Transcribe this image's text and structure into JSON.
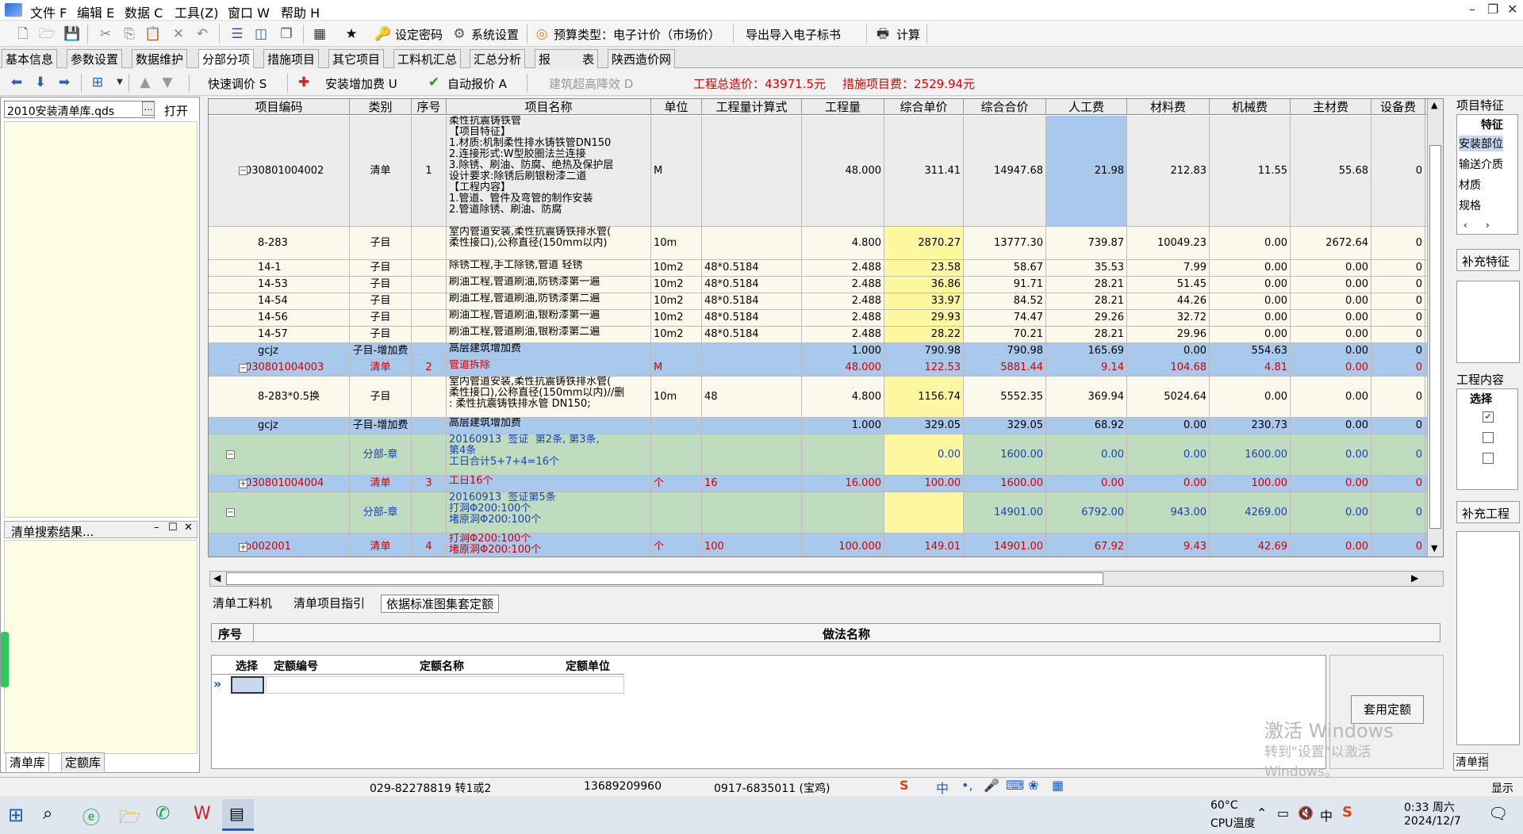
{
  "menu": [
    "文件 F",
    "编辑 E",
    "数据 C",
    "工具(Z)",
    "窗口 W",
    "帮助 H"
  ],
  "toolbar": {
    "set_password": "设定密码",
    "system_settings": "系统设置",
    "budget_type": "预算类型：电子计价（市场价）",
    "export_import": "导出导入电子标书",
    "calculate": "计算"
  },
  "tabs": [
    "基本信息",
    "参数设置",
    "数据维护",
    "分部分项",
    "措施项目",
    "其它项目",
    "工料机汇总",
    "汇总分析",
    "报",
    "表",
    "陕西造价网"
  ],
  "toolbar2": {
    "quick_adjust": "快速调价 S",
    "install_fee": "安装增加费 U",
    "auto_report": "自动报价 A",
    "building_over_height": "建筑超高降效 D",
    "total_cost": "工程总造价：43971.5元",
    "measure_cost": "措施项目费：2529.94元"
  },
  "left": {
    "library": "2010安装清单库.qds",
    "open_button": "打开",
    "search_results_title": "清单搜索结果...",
    "tab_list_lib": "清单库",
    "tab_quota_lib": "定额库"
  },
  "grid": {
    "headers": [
      "项目编码",
      "类别",
      "序号",
      "项目名称",
      "单位",
      "工程量计算式",
      "工程量",
      "综合单价",
      "综合合价",
      "人工费",
      "材料费",
      "机械费",
      "主材费",
      "设备费"
    ],
    "rows": [
      {
        "code": "030801004002",
        "type": "清单",
        "seq": "1",
        "name": "柔性抗震铸铁管\n【项目特征】\n1.材质:机制柔性排水铸铁管DN150\n2.连接形式:W型胶圈法兰连接\n3.除锈、刷油、防腐、绝热及保护层\n设计要求:除锈后刷银粉漆二道\n【工程内容】\n1.管道、管件及弯管的制作安装\n2.管道除锈、刷油、防腐",
        "unit": "M",
        "formula": "",
        "qty": "48.000",
        "unit_price": "311.41",
        "total": "14947.68",
        "labor": "21.98",
        "material": "212.83",
        "machine": "11.55",
        "main_mat": "55.68",
        "equip": "0",
        "style": "qd",
        "expander": "−"
      },
      {
        "code": "8-283",
        "type": "子目",
        "seq": "",
        "name": "室内管道安装,柔性抗震铸铁排水管(\n柔性接口),公称直径(150mm以内)",
        "unit": "10m",
        "formula": "",
        "qty": "4.800",
        "unit_price": "2870.27",
        "total": "13777.30",
        "labor": "739.87",
        "material": "10049.23",
        "machine": "0.00",
        "main_mat": "2672.64",
        "equip": "0",
        "style": "zm",
        "expander": ""
      },
      {
        "code": "14-1",
        "type": "子目",
        "seq": "",
        "name": "除锈工程,手工除锈,管道 轻锈",
        "unit": "10m2",
        "formula": "48*0.5184",
        "qty": "2.488",
        "unit_price": "23.58",
        "total": "58.67",
        "labor": "35.53",
        "material": "7.99",
        "machine": "0.00",
        "main_mat": "0.00",
        "equip": "0",
        "style": "zm",
        "expander": ""
      },
      {
        "code": "14-53",
        "type": "子目",
        "seq": "",
        "name": "刷油工程,管道刷油,防锈漆第一遍",
        "unit": "10m2",
        "formula": "48*0.5184",
        "qty": "2.488",
        "unit_price": "36.86",
        "total": "91.71",
        "labor": "28.21",
        "material": "51.45",
        "machine": "0.00",
        "main_mat": "0.00",
        "equip": "0",
        "style": "zm",
        "expander": ""
      },
      {
        "code": "14-54",
        "type": "子目",
        "seq": "",
        "name": "刷油工程,管道刷油,防锈漆第二遍",
        "unit": "10m2",
        "formula": "48*0.5184",
        "qty": "2.488",
        "unit_price": "33.97",
        "total": "84.52",
        "labor": "28.21",
        "material": "44.26",
        "machine": "0.00",
        "main_mat": "0.00",
        "equip": "0",
        "style": "zm",
        "expander": ""
      },
      {
        "code": "14-56",
        "type": "子目",
        "seq": "",
        "name": "刷油工程,管道刷油,银粉漆第一遍",
        "unit": "10m2",
        "formula": "48*0.5184",
        "qty": "2.488",
        "unit_price": "29.93",
        "total": "74.47",
        "labor": "29.26",
        "material": "32.72",
        "machine": "0.00",
        "main_mat": "0.00",
        "equip": "0",
        "style": "zm",
        "expander": ""
      },
      {
        "code": "14-57",
        "type": "子目",
        "seq": "",
        "name": "刷油工程,管道刷油,银粉漆第二遍",
        "unit": "10m2",
        "formula": "48*0.5184",
        "qty": "2.488",
        "unit_price": "28.22",
        "total": "70.21",
        "labor": "28.21",
        "material": "29.96",
        "machine": "0.00",
        "main_mat": "0.00",
        "equip": "0",
        "style": "zm",
        "expander": ""
      },
      {
        "code": "gcjz",
        "type": "子目-增加费",
        "seq": "",
        "name": "高层建筑增加费",
        "unit": "",
        "formula": "",
        "qty": "1.000",
        "unit_price": "790.98",
        "total": "790.98",
        "labor": "165.69",
        "material": "0.00",
        "machine": "554.63",
        "main_mat": "0.00",
        "equip": "0",
        "style": "blue",
        "expander": ""
      },
      {
        "code": "030801004003",
        "type": "清单",
        "seq": "2",
        "name": "管道拆除",
        "unit": "M",
        "formula": "",
        "qty": "48.000",
        "unit_price": "122.53",
        "total": "5881.44",
        "labor": "9.14",
        "material": "104.68",
        "machine": "4.81",
        "main_mat": "0.00",
        "equip": "0",
        "style": "bluered",
        "expander": "−"
      },
      {
        "code": "8-283*0.5换",
        "type": "子目",
        "seq": "",
        "name": "室内管道安装,柔性抗震铸铁排水管(\n柔性接口),公称直径(150mm以内)//删\n: 柔性抗震铸铁排水管 DN150;",
        "unit": "10m",
        "formula": "48",
        "qty": "4.800",
        "unit_price": "1156.74",
        "total": "5552.35",
        "labor": "369.94",
        "material": "5024.64",
        "machine": "0.00",
        "main_mat": "0.00",
        "equip": "0",
        "style": "zm",
        "expander": ""
      },
      {
        "code": "gcjz",
        "type": "子目-增加费",
        "seq": "",
        "name": "高层建筑增加费",
        "unit": "",
        "formula": "",
        "qty": "1.000",
        "unit_price": "329.05",
        "total": "329.05",
        "labor": "68.92",
        "material": "0.00",
        "machine": "230.73",
        "main_mat": "0.00",
        "equip": "0",
        "style": "blue",
        "expander": ""
      },
      {
        "code": "",
        "type": "分部-章",
        "seq": "",
        "name": "20160913  签证  第2条, 第3条,\n第4条\n工日合计5+7+4=16个",
        "unit": "",
        "formula": "",
        "qty": "",
        "unit_price": "0.00",
        "total": "1600.00",
        "labor": "0.00",
        "material": "0.00",
        "machine": "1600.00",
        "main_mat": "0.00",
        "equip": "0",
        "style": "green",
        "expander": "−"
      },
      {
        "code": "030801004004",
        "type": "清单",
        "seq": "3",
        "name": "工日16个",
        "unit": "个",
        "formula": "16",
        "qty": "16.000",
        "unit_price": "100.00",
        "total": "1600.00",
        "labor": "0.00",
        "material": "0.00",
        "machine": "100.00",
        "main_mat": "0.00",
        "equip": "0",
        "style": "bluered",
        "expander": "+"
      },
      {
        "code": "",
        "type": "分部-章",
        "seq": "",
        "name": "20160913  签证第5条\n打洞Φ200:100个\n堵原洞Φ200:100个",
        "unit": "",
        "formula": "",
        "qty": "",
        "unit_price": "",
        "total": "14901.00",
        "labor": "6792.00",
        "material": "943.00",
        "machine": "4269.00",
        "main_mat": "0.00",
        "equip": "0",
        "style": "green",
        "expander": "−"
      },
      {
        "code": "b002001",
        "type": "清单",
        "seq": "4",
        "name": "打洞Φ200:100个\n堵原洞Φ200:100个",
        "unit": "个",
        "formula": "100",
        "qty": "100.000",
        "unit_price": "149.01",
        "total": "14901.00",
        "labor": "67.92",
        "material": "9.43",
        "machine": "42.69",
        "main_mat": "0.00",
        "equip": "0",
        "style": "bluered",
        "expander": "+"
      }
    ]
  },
  "bottom": {
    "tabs": [
      "清单工料机",
      "清单项目指引",
      "依据标准图集套定额"
    ],
    "header_seq": "序号",
    "header_method": "做法名称",
    "sub_headers": [
      "选择",
      "定额编号",
      "定额名称",
      "定额单位"
    ],
    "apply_button": "套用定额",
    "activate_line1": "激活 Windows",
    "activate_line2": "转到\"设置\"以激活 Windows。"
  },
  "right": {
    "feature_title": "项目特征",
    "feature_col": "特征",
    "features": [
      "安装部位",
      "输送介质",
      "材质",
      "规格"
    ],
    "supplement_feature": "补充特征",
    "content_title": "工程内容",
    "content_col": "选择",
    "supplement_content": "补充工程",
    "list_guide": "清单指引"
  },
  "status": {
    "phone1": "029-82278819 转1或2",
    "phone2": "13689209960",
    "phone3": "0917-6835011 (宝鸡)",
    "display": "显示"
  },
  "taskbar": {
    "temp": "60°C",
    "temp_label": "CPU温度",
    "ime": "中",
    "time": "0:33 周六",
    "date": "2024/12/7"
  }
}
